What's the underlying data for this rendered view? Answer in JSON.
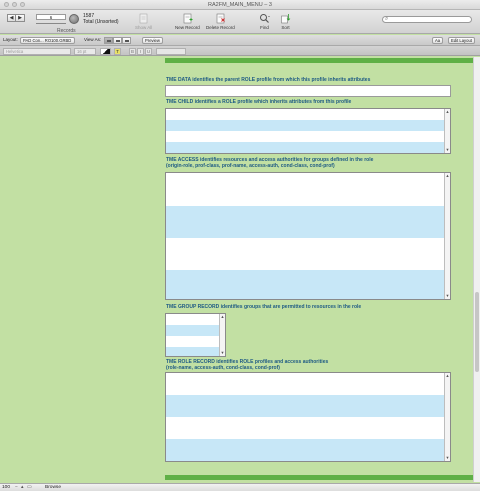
{
  "window": {
    "title": "RA2FM_MAIN_MENU – 3"
  },
  "toolbar": {
    "record_current": "6",
    "record_total": "1587",
    "record_total_label": "Total (Unsorted)",
    "records_label": "Records",
    "show_all": "Show All",
    "new_record": "New Record",
    "delete_record": "Delete Record",
    "find": "Find",
    "sort": "Sort",
    "search_placeholder": ""
  },
  "layout_bar": {
    "layout_label": "Layout:",
    "layout_value": "PAD Con... RO100.GRBD",
    "view_as_label": "View As:",
    "preview": "Preview",
    "aa": "Aa",
    "edit_layout": "Edit Layout"
  },
  "format_bar": {
    "font": "Helvetica",
    "size": "16 pt",
    "bold": "B",
    "italic": "I",
    "underline": "U"
  },
  "sections": {
    "tme_data": "TME DATA identifies the parent ROLE profile from which this profile inherits attributes",
    "tme_child": "TME CHILD identifies a ROLE profile which inherits attributes from this profile",
    "tme_access_1": "TME ACCESS identifies resources and access authorities for groups defined in the role",
    "tme_access_2": "(origin-role, prof-class, prof-name, access-auth, cond-class, cond-prof)",
    "tme_group": "TME GROUP RECORD identifies groups that are permitted to resources in the role",
    "tme_role_1": "TME ROLE RECORD identifies ROLE profiles and access authorities",
    "tme_role_2": "(role-name, access-auth, cond-class, cond-prof)"
  },
  "status_bar": {
    "zoom": "100",
    "mode": "Browse"
  },
  "colors": {
    "background": "#c2e0a3",
    "accent_bar": "#5fb046",
    "label_text": "#1e5a84",
    "portal_alt_row": "#c7e7f7"
  },
  "icons": [
    "nav-back-icon",
    "nav-forward-icon",
    "show-all-icon",
    "new-record-icon",
    "delete-record-icon",
    "find-icon",
    "sort-icon",
    "search-icon"
  ]
}
